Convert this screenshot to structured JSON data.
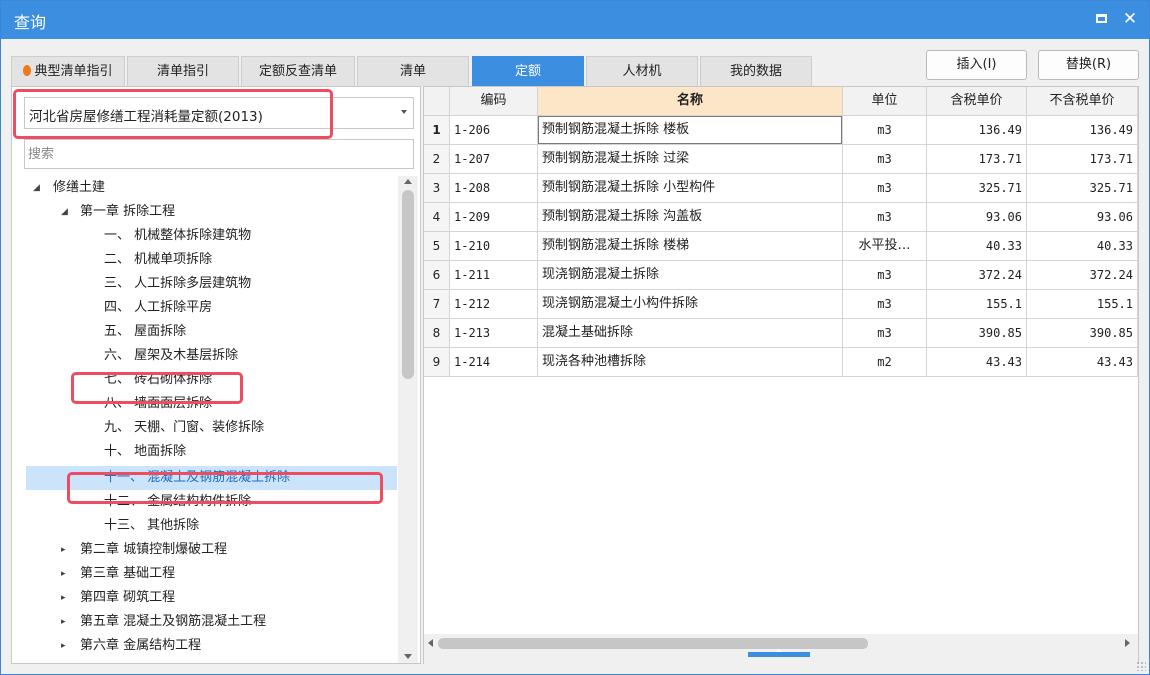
{
  "window": {
    "title": "查询"
  },
  "tabs": [
    {
      "label": "典型清单指引",
      "icon": "flame-icon",
      "active": false
    },
    {
      "label": "清单指引",
      "active": false
    },
    {
      "label": "定额反查清单",
      "active": false
    },
    {
      "label": "清单",
      "active": false
    },
    {
      "label": "定额",
      "active": true
    },
    {
      "label": "人材机",
      "active": false
    },
    {
      "label": "我的数据",
      "active": false
    }
  ],
  "actions": {
    "insert": "插入(I)",
    "replace": "替换(R)"
  },
  "left": {
    "library": "河北省房屋修缮工程消耗量定额(2013)",
    "search_placeholder": "搜索",
    "tree": [
      "修缮土建",
      "第一章 拆除工程",
      "一、 机械整体拆除建筑物",
      "二、 机械单项拆除",
      "三、 人工拆除多层建筑物",
      "四、 人工拆除平房",
      "五、 屋面拆除",
      "六、 屋架及木基层拆除",
      "七、 砖石砌体拆除",
      "八、 墙面面层拆除",
      "九、 天棚、门窗、装修拆除",
      "十、 地面拆除",
      "十一、 混凝土及钢筋混凝土拆除",
      "十二、 金属结构构件拆除",
      "十三、 其他拆除",
      "第二章 城镇控制爆破工程",
      "第三章 基础工程",
      "第四章 砌筑工程",
      "第五章 混凝土及钢筋混凝土工程",
      "第六章 金属结构工程"
    ],
    "selected_index": 12
  },
  "grid": {
    "headers": [
      "编码",
      "名称",
      "单位",
      "含税单价",
      "不含税单价"
    ],
    "rows": [
      {
        "no": "1",
        "code": "1-206",
        "name": "预制钢筋混凝土拆除 楼板",
        "unit": "m3",
        "tax": "136.49",
        "notax": "136.49"
      },
      {
        "no": "2",
        "code": "1-207",
        "name": "预制钢筋混凝土拆除 过梁",
        "unit": "m3",
        "tax": "173.71",
        "notax": "173.71"
      },
      {
        "no": "3",
        "code": "1-208",
        "name": "预制钢筋混凝土拆除 小型构件",
        "unit": "m3",
        "tax": "325.71",
        "notax": "325.71"
      },
      {
        "no": "4",
        "code": "1-209",
        "name": "预制钢筋混凝土拆除 沟盖板",
        "unit": "m3",
        "tax": "93.06",
        "notax": "93.06"
      },
      {
        "no": "5",
        "code": "1-210",
        "name": "预制钢筋混凝土拆除 楼梯",
        "unit": "水平投…",
        "tax": "40.33",
        "notax": "40.33"
      },
      {
        "no": "6",
        "code": "1-211",
        "name": "现浇钢筋混凝土拆除",
        "unit": "m3",
        "tax": "372.24",
        "notax": "372.24"
      },
      {
        "no": "7",
        "code": "1-212",
        "name": "现浇钢筋混凝土小构件拆除",
        "unit": "m3",
        "tax": "155.1",
        "notax": "155.1"
      },
      {
        "no": "8",
        "code": "1-213",
        "name": "混凝土基础拆除",
        "unit": "m3",
        "tax": "390.85",
        "notax": "390.85"
      },
      {
        "no": "9",
        "code": "1-214",
        "name": "现浇各种池槽拆除",
        "unit": "m2",
        "tax": "43.43",
        "notax": "43.43"
      }
    ]
  },
  "colors": {
    "accent": "#3b8ee0",
    "highlight": "#ec4e60",
    "selection": "#cbe4fb",
    "sorted_header": "#fde6c8"
  }
}
